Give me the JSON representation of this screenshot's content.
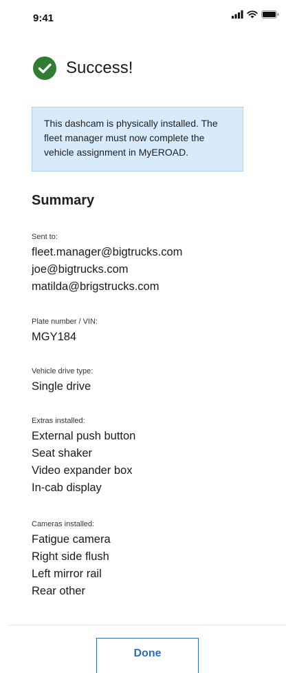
{
  "status_bar": {
    "time": "9:41",
    "icons": [
      "signal-icon",
      "wifi-icon",
      "battery-icon"
    ]
  },
  "header": {
    "icon": "check-circle-icon",
    "title": "Success!"
  },
  "info": {
    "message": "This dashcam is physically installed. The fleet manager must now complete the vehicle assignment in MyEROAD."
  },
  "summary": {
    "title": "Summary",
    "sent_to": {
      "label": "Sent to:",
      "values": [
        "fleet.manager@bigtrucks.com",
        "joe@bigtrucks.com",
        "matilda@brigstrucks.com"
      ]
    },
    "plate": {
      "label": "Plate number / VIN:",
      "values": [
        "MGY184"
      ]
    },
    "drive_type": {
      "label": "Vehicle drive type:",
      "values": [
        "Single drive"
      ]
    },
    "extras": {
      "label": "Extras installed:",
      "values": [
        "External push button",
        "Seat shaker",
        "Video expander box",
        "In-cab display"
      ]
    },
    "cameras": {
      "label": "Cameras installed:",
      "values": [
        "Fatigue camera",
        "Right side flush",
        "Left mirror rail",
        "Rear other"
      ]
    }
  },
  "footer": {
    "done_label": "Done"
  },
  "colors": {
    "success_green": "#2e7d32",
    "info_bg": "#d7ebfa",
    "info_border": "#a9d0ee",
    "accent_blue": "#2a6fb5"
  }
}
